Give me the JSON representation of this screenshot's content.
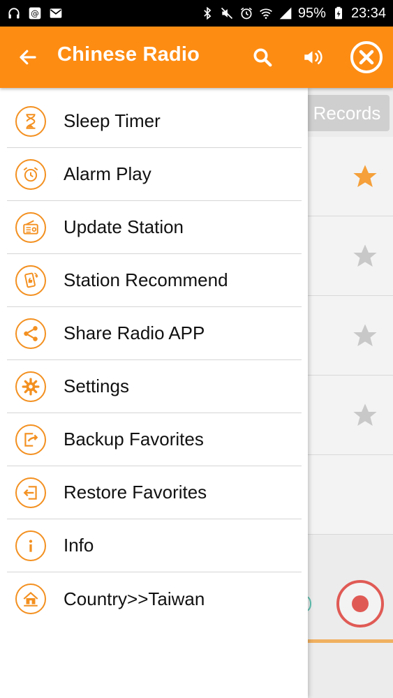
{
  "status_bar": {
    "battery": "95%",
    "time": "23:34",
    "icons_left": [
      "headphones-icon",
      "email-at-icon",
      "mail-icon"
    ],
    "icons_right": [
      "bluetooth-icon",
      "mute-icon",
      "alarm-icon",
      "wifi-icon",
      "signal-icon",
      "battery-icon"
    ]
  },
  "app_bar": {
    "title": "Chinese Radio",
    "back_icon": "arrow-left-icon",
    "search_icon": "search-icon",
    "volume_icon": "volume-icon",
    "close_icon": "close-circle-icon"
  },
  "colors": {
    "accent": "#fd8c13",
    "icon_orange": "#f39020",
    "record_red": "#e05a55",
    "star_active": "#f5a03a",
    "star_inactive": "#c8c8c8"
  },
  "background": {
    "tab_label": "Records",
    "rows": [
      {
        "star": "active"
      },
      {
        "star": "inactive"
      },
      {
        "star": "inactive"
      },
      {
        "star": "inactive"
      },
      {
        "star": "none"
      }
    ]
  },
  "drawer": {
    "items": [
      {
        "label": "Sleep Timer",
        "icon": "hourglass-icon"
      },
      {
        "label": "Alarm Play",
        "icon": "alarm-clock-icon"
      },
      {
        "label": "Update Station",
        "icon": "radio-icon"
      },
      {
        "label": "Station Recommend",
        "icon": "thumbs-up-phone-icon"
      },
      {
        "label": "Share Radio APP",
        "icon": "share-icon"
      },
      {
        "label": "Settings",
        "icon": "gear-icon"
      },
      {
        "label": "Backup Favorites",
        "icon": "export-icon"
      },
      {
        "label": "Restore Favorites",
        "icon": "import-icon"
      },
      {
        "label": "Info",
        "icon": "info-icon"
      },
      {
        "label": "Country>>Taiwan",
        "icon": "home-icon"
      }
    ]
  }
}
